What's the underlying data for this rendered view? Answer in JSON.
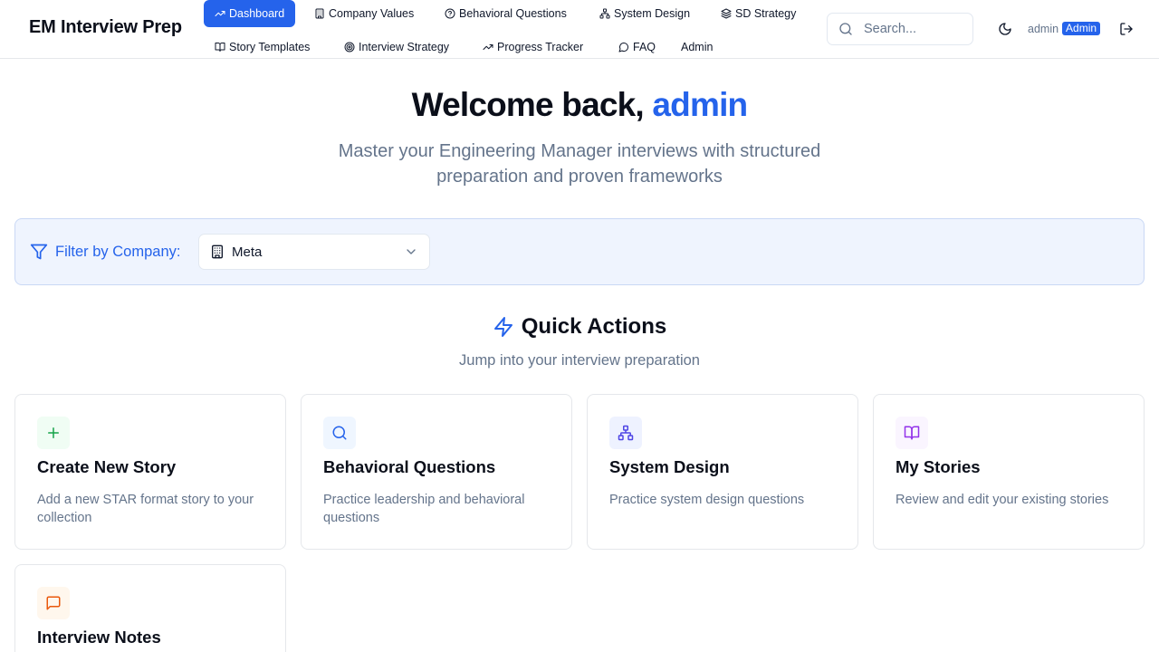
{
  "app": {
    "title": "EM Interview Prep"
  },
  "nav": {
    "items": [
      {
        "label": "Dashboard",
        "icon": "trending-up-icon",
        "active": true
      },
      {
        "label": "Company Values",
        "icon": "building-icon"
      },
      {
        "label": "Behavioral Questions",
        "icon": "help-circle-icon"
      },
      {
        "label": "System Design",
        "icon": "network-icon"
      },
      {
        "label": "SD Strategy",
        "icon": "layers-icon"
      },
      {
        "label": "Story Templates",
        "icon": "book-open-icon"
      },
      {
        "label": "Interview Strategy",
        "icon": "target-icon"
      },
      {
        "label": "Progress Tracker",
        "icon": "trending-up-icon"
      },
      {
        "label": "FAQ",
        "icon": "message-circle-icon"
      },
      {
        "label": "Admin"
      }
    ]
  },
  "search": {
    "placeholder": "Search..."
  },
  "user": {
    "name": "admin",
    "role_badge": "Admin"
  },
  "hero": {
    "greeting": "Welcome back,",
    "name": "admin",
    "subtitle": "Master your Engineering Manager interviews with structured preparation and proven frameworks"
  },
  "filter": {
    "label": "Filter by Company:",
    "selected": "Meta"
  },
  "quick_actions": {
    "title": "Quick Actions",
    "subtitle": "Jump into your interview preparation",
    "cards": [
      {
        "title": "Create New Story",
        "description": "Add a new STAR format story to your collection",
        "icon": "plus-icon",
        "color": "#16a34a",
        "bg": "#f0fdf4"
      },
      {
        "title": "Behavioral Questions",
        "description": "Practice leadership and behavioral questions",
        "icon": "search-icon",
        "color": "#2563eb",
        "bg": "#eff6ff"
      },
      {
        "title": "System Design",
        "description": "Practice system design questions",
        "icon": "network-icon",
        "color": "#4f46e5",
        "bg": "#eef2ff"
      },
      {
        "title": "My Stories",
        "description": "Review and edit your existing stories",
        "icon": "book-open-icon",
        "color": "#9333ea",
        "bg": "#faf5ff"
      },
      {
        "title": "Interview Notes",
        "description": "",
        "icon": "message-square-icon",
        "color": "#ea580c",
        "bg": "#fff7ed"
      }
    ]
  }
}
